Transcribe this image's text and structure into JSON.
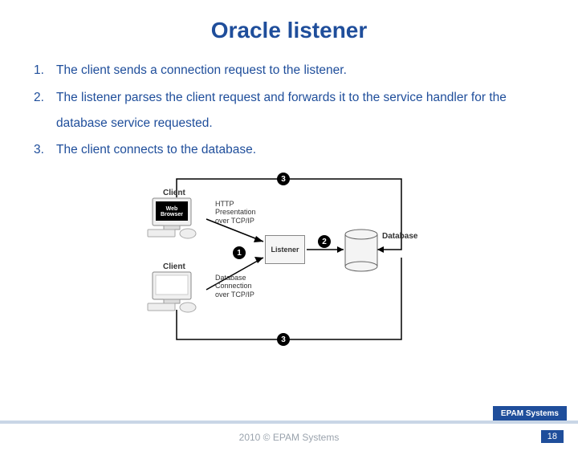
{
  "title": "Oracle listener",
  "list": [
    "The client sends a connection request to the listener.",
    "The listener parses the client request and forwards it to the service handler for the database service requested.",
    "The client connects to the database."
  ],
  "diagram": {
    "client_top": "Client",
    "client_bottom": "Client",
    "web_browser": "Web\nBrowser",
    "http_label": "HTTP\nPresentation\nover TCP/IP",
    "db_conn_label": "Database\nConnection\nover TCP/IP",
    "listener": "Listener",
    "database": "Database",
    "badge1": "1",
    "badge2": "2",
    "badge3a": "3",
    "badge3b": "3"
  },
  "footer": {
    "brand": "EPAM Systems",
    "copyright": "2010 © EPAM Systems",
    "page": "18"
  }
}
